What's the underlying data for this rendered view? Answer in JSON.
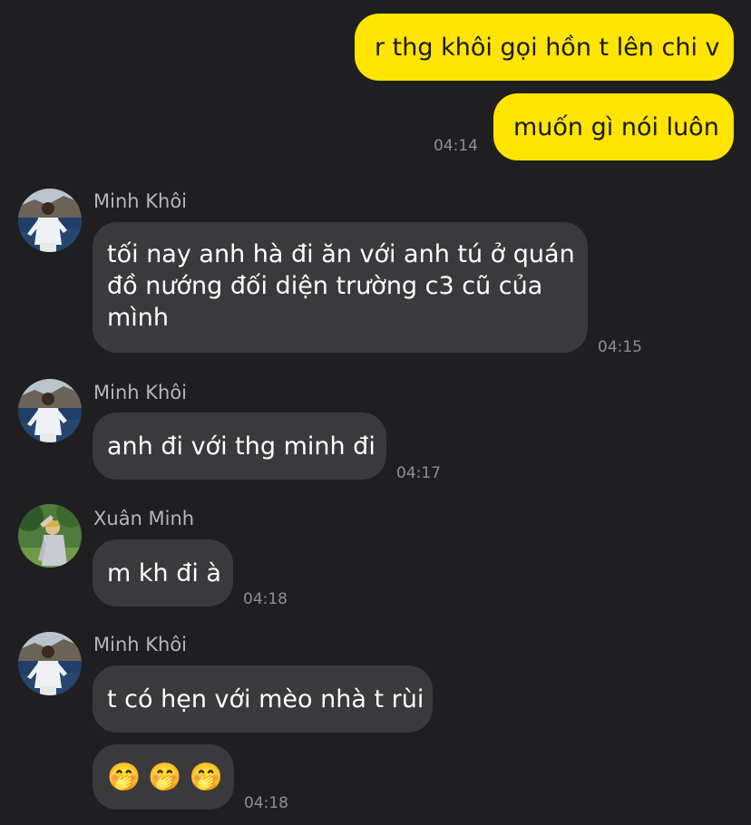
{
  "messages": {
    "m1": {
      "text": "r thg khôi gọi hồn t lên chi v"
    },
    "m2": {
      "text": "muốn gì nói luôn",
      "time": "04:14"
    },
    "m3": {
      "sender": "Minh Khôi",
      "lines": [
        "tối nay anh hà đi ăn với anh tú ở quán",
        "đồ nướng đối diện trường c3 cũ của",
        "mình"
      ],
      "time": "04:15"
    },
    "m4": {
      "sender": "Minh Khôi",
      "text": "anh đi với thg minh đi",
      "time": "04:17"
    },
    "m5": {
      "sender": "Xuân Minh",
      "text": "m kh đi à",
      "time": "04:18"
    },
    "m6": {
      "sender": "Minh Khôi",
      "text": "t có hẹn với mèo nhà t rùi"
    },
    "m7": {
      "emojis": [
        "🤭",
        "🤭",
        "🤭"
      ],
      "time": "04:18"
    }
  },
  "icons": {
    "avatar_minh_khoi": "avatar-minh-khoi",
    "avatar_xuan_minh": "avatar-xuan-minh",
    "emoji": "face-with-hand-over-mouth"
  },
  "colors": {
    "background": "#1f1f21",
    "my_bubble": "#fee500",
    "their_bubble": "#3a3a3c",
    "timestamp": "#8e8e93"
  }
}
